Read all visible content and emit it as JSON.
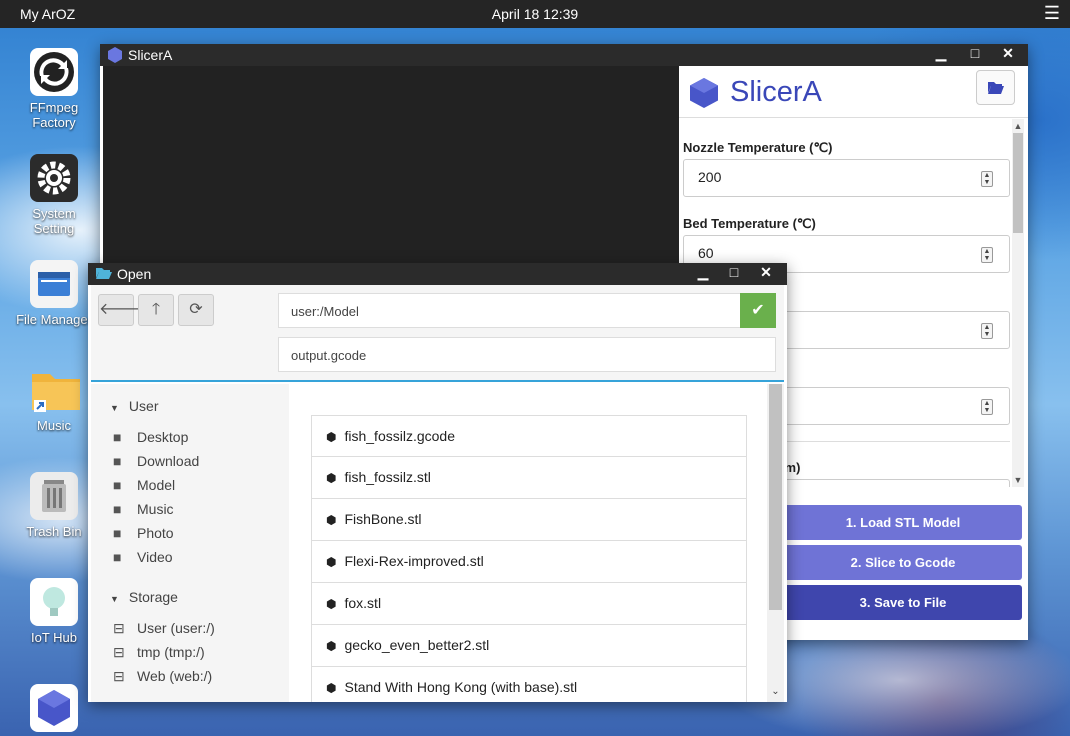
{
  "topbar": {
    "brand": "My ArOZ",
    "clock": "April 18 12:39",
    "menu_glyph": "☰"
  },
  "desktop": {
    "icons": [
      {
        "label": "FFmpeg Factory",
        "icon": "ffmpeg-factory-icon"
      },
      {
        "label": "System Setting",
        "icon": "gear-icon"
      },
      {
        "label": "File Manager",
        "icon": "file-manager-icon"
      },
      {
        "label": "Music",
        "icon": "folder-shortcut-icon"
      },
      {
        "label": "Trash Bin",
        "icon": "trash-bin-icon"
      },
      {
        "label": "IoT Hub",
        "icon": "lightbulb-icon"
      },
      {
        "label": "",
        "icon": "slicera-icon"
      }
    ]
  },
  "slicer_window": {
    "title": "SlicerA",
    "controls": {
      "minimize": "▁",
      "maximize": "□",
      "close": "✕"
    },
    "app_title": "SlicerA",
    "settings": {
      "nozzle_label": "Nozzle Temperature (℃)",
      "nozzle_value": "200",
      "bed_label": "Bed Temperature (℃)",
      "bed_value": "60",
      "partial_label": "mm)"
    },
    "buttons": {
      "load": "1. Load STL Model",
      "slice": "2. Slice to Gcode",
      "save": "3. Save to File"
    },
    "colors": {
      "accent": "#3a47b8",
      "button_light": "#6f73d6",
      "button_dark": "#3f46ad"
    }
  },
  "open_dialog": {
    "title": "Open",
    "controls": {
      "minimize": "▁",
      "maximize": "□",
      "close": "✕"
    },
    "path": "user:/Model",
    "filename": "output.gcode",
    "tree": {
      "user_group": "User",
      "user_items": [
        "Desktop",
        "Download",
        "Model",
        "Music",
        "Photo",
        "Video"
      ],
      "storage_group": "Storage",
      "storage_items": [
        "User (user:/)",
        "tmp (tmp:/)",
        "Web (web:/)"
      ]
    },
    "files": [
      "fish_fossilz.gcode",
      "fish_fossilz.stl",
      "FishBone.stl",
      "Flexi-Rex-improved.stl",
      "fox.stl",
      "gecko_even_better2.stl",
      "Stand With Hong Kong (with base).stl"
    ],
    "colors": {
      "ok": "#6ab04c",
      "divider": "#36a3d9"
    }
  }
}
